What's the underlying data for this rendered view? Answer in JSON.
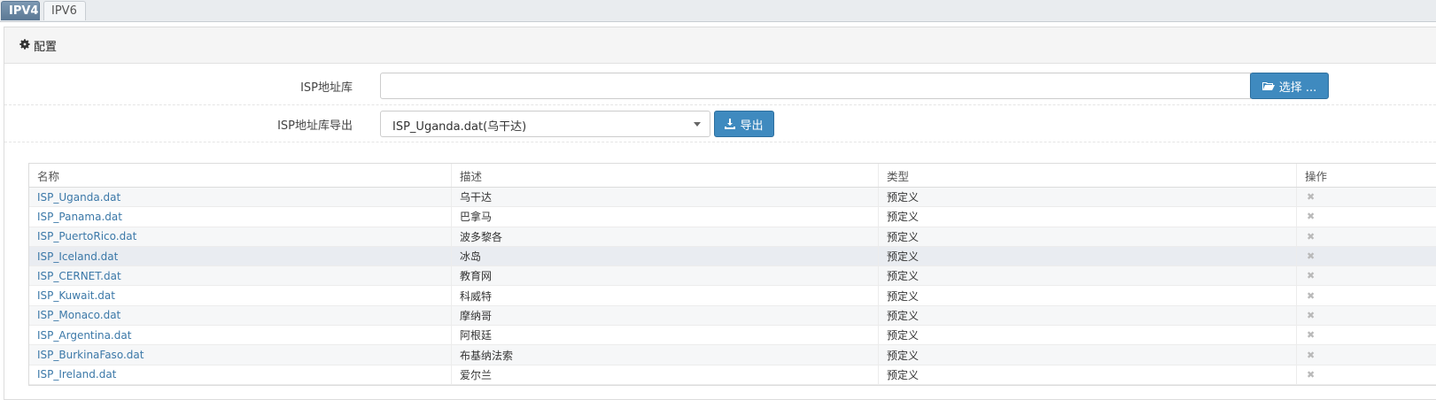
{
  "tabs": [
    {
      "label": "IPV4",
      "active": true
    },
    {
      "label": "IPV6",
      "active": false
    }
  ],
  "panel": {
    "icon": "gear-icon",
    "title": "配置"
  },
  "form": {
    "isp_library_label": "ISP地址库",
    "isp_library_value": "",
    "choose_button_label": "选择 ...",
    "choose_button_icon": "folder-open-icon",
    "export_label": "ISP地址库导出",
    "export_selected": "ISP_Uganda.dat(乌干达)",
    "export_button_label": "导出",
    "export_button_icon": "download-icon"
  },
  "table": {
    "columns": [
      "名称",
      "描述",
      "类型",
      "操作"
    ],
    "rows": [
      {
        "name": "ISP_Uganda.dat",
        "desc": "乌干达",
        "type": "预定义",
        "action": "✖"
      },
      {
        "name": "ISP_Panama.dat",
        "desc": "巴拿马",
        "type": "预定义",
        "action": "✖"
      },
      {
        "name": "ISP_PuertoRico.dat",
        "desc": "波多黎各",
        "type": "预定义",
        "action": "✖"
      },
      {
        "name": "ISP_Iceland.dat",
        "desc": "冰岛",
        "type": "预定义",
        "action": "✖"
      },
      {
        "name": "ISP_CERNET.dat",
        "desc": "教育网",
        "type": "预定义",
        "action": "✖"
      },
      {
        "name": "ISP_Kuwait.dat",
        "desc": "科威特",
        "type": "预定义",
        "action": "✖"
      },
      {
        "name": "ISP_Monaco.dat",
        "desc": "摩纳哥",
        "type": "预定义",
        "action": "✖"
      },
      {
        "name": "ISP_Argentina.dat",
        "desc": "阿根廷",
        "type": "预定义",
        "action": "✖"
      },
      {
        "name": "ISP_BurkinaFaso.dat",
        "desc": "布基纳法索",
        "type": "预定义",
        "action": "✖"
      },
      {
        "name": "ISP_Ireland.dat",
        "desc": "爱尔兰",
        "type": "预定义",
        "action": "✖"
      }
    ]
  },
  "colors": {
    "active_tab": "#5b7894",
    "primary_button": "#3f8abf",
    "link": "#3b78a8"
  }
}
